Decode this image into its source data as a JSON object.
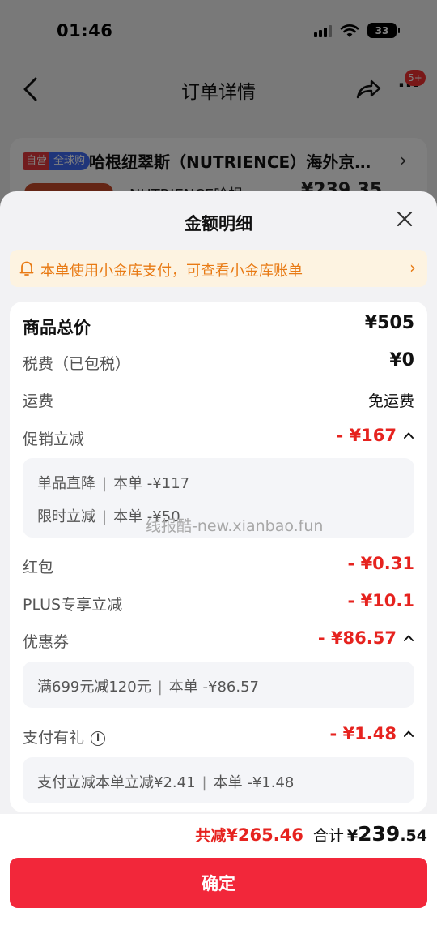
{
  "status_bar": {
    "time": "01:46",
    "battery": "33"
  },
  "nav": {
    "title": "订单详情",
    "badge": "5+"
  },
  "background_card": {
    "tag_self": "自营",
    "tag_global": "全球购",
    "store_name": "哈根纽翠斯（NUTRIENCE）海外京…",
    "product_text_partial": "NUTRIENCE哈根",
    "product_price_partial": "¥239.35"
  },
  "sheet": {
    "title": "金额明细",
    "notice": "本单使用小金库支付，可查看小金库账单",
    "rows": {
      "goods_total": {
        "label": "商品总价",
        "value": "¥505"
      },
      "tax": {
        "label": "税费（已包税）",
        "value": "¥0"
      },
      "shipping": {
        "label": "运费",
        "value": "免运费"
      },
      "promo": {
        "label": "促销立减",
        "value": "- ¥167"
      },
      "red_packet": {
        "label": "红包",
        "value": "- ¥0.31"
      },
      "plus": {
        "label": "PLUS专享立减",
        "value": "- ¥10.1"
      },
      "coupon": {
        "label": "优惠券",
        "value": "- ¥86.57"
      },
      "pay_gift": {
        "label": "支付有礼",
        "value": "- ¥1.48"
      }
    },
    "promo_details": [
      {
        "name": "单品直降",
        "sep": "|",
        "detail": "本单 -¥117"
      },
      {
        "name": "限时立减",
        "sep": "|",
        "detail": "本单 -¥50"
      }
    ],
    "coupon_details": [
      {
        "name": "满699元减120元",
        "sep": "|",
        "detail": "本单 -¥86.57"
      }
    ],
    "pay_gift_details": [
      {
        "name": "支付立减本单立减¥2.41",
        "sep": "|",
        "detail": "本单 -¥1.48"
      }
    ],
    "watermark": "线报酷-new.xianbao.fun"
  },
  "footer": {
    "save_label": "共减",
    "save_amount": "¥265.46",
    "total_label": "合计",
    "total_symbol": "¥",
    "total_integer": "239",
    "total_decimal": ".54",
    "confirm_label": "确定"
  },
  "colors": {
    "accent_red": "#e6231f",
    "button_red": "#f2273a",
    "notice_orange": "#e87a14",
    "notice_bg": "#fdf3e1"
  }
}
